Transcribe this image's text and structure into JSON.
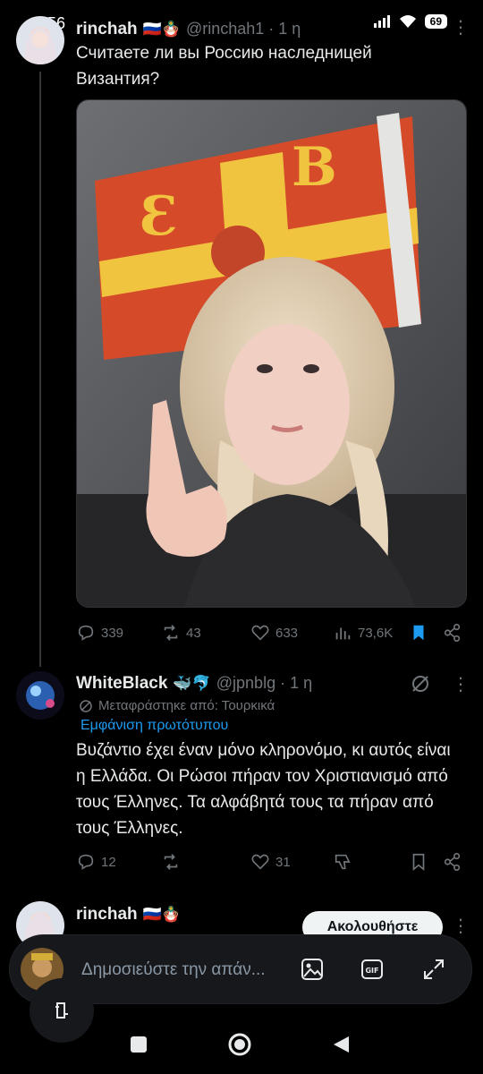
{
  "status_bar": {
    "time": "1:56",
    "battery": "69"
  },
  "post1": {
    "display_name": "rinchah",
    "badges": "🇷🇺🪆",
    "handle": "@rinchah1 · 1 η",
    "text": "Считаете ли вы Россию наследницей Византия?",
    "stats": {
      "replies": "339",
      "reposts": "43",
      "likes": "633",
      "views": "73,6K"
    }
  },
  "post2": {
    "display_name": "WhiteBlack",
    "badges": "🐳🐬",
    "handle": "@jpnblg · 1 η",
    "translated_label": "Μεταφράστηκε από: Τουρκικά",
    "show_original": "Εμφάνιση πρωτότυπου",
    "text": "Βυζάντιο έχει έναν μόνο κληρονόμο, κι αυτός είναι η Ελλάδα. Οι Ρώσοι πήραν τον Χριστιανισμό από τους Έλληνες. Τα αλφάβητά τους τα πήραν από τους Έλληνες.",
    "stats": {
      "replies": "12",
      "likes": "31"
    }
  },
  "post3": {
    "display_name": "rinchah",
    "badges": "🇷🇺🪆",
    "follow_label": "Ακολουθήστε"
  },
  "reply_bar": {
    "placeholder": "Δημοσιεύστε την απάν..."
  },
  "colors": {
    "accent": "#1d9bf0",
    "muted": "#71767b",
    "text": "#e7e9ea"
  }
}
